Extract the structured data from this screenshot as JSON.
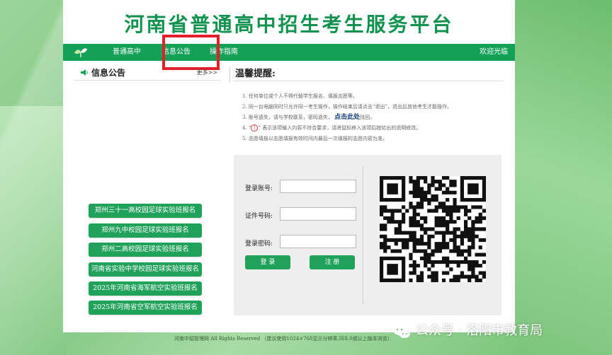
{
  "banner": {
    "title": "河南省普通高中招生考生服务平台"
  },
  "nav": {
    "items": [
      "普通高中",
      "信息公告",
      "操作指南"
    ],
    "welcome": "欢迎光临"
  },
  "info": {
    "title": "信息公告",
    "more": "更多>>",
    "buttons": [
      "郑州三十一高校园足球实验班报名",
      "郑州九中校园足球实验班报名",
      "郑州二高校园足球实验班报名",
      "河南省实验中学校园足球实验班报名",
      "2025年河南省海军航空实验班报名",
      "2025年河南省空军航空实验班报名"
    ]
  },
  "tips": {
    "title": "温馨提醒:",
    "items": [
      "1. 任何单位或个人不得代替学生报名、填报志愿等。",
      "2. 同一台电脑同时只允许同一考生操作，操作结束后请点击“退出”，退出后其他考生才能操作。",
      "3. 账号遗失，请与学校联系，密码遗失，",
      "4. “",
      "5. 志愿填报以志愿填报有效时间内最后一次填报的志愿内容为准。"
    ],
    "item3_link": "点击此处",
    "item3_after": "找回。",
    "item4_symbol": "!",
    "item4_after": "” 表示该项输入内容不符合要求，请将鼠标移入该项后按给出的说明修改。"
  },
  "login": {
    "account_label": "登录账号:",
    "id_label": "证件号码:",
    "password_label": "登录密码:",
    "account_value": "",
    "id_value": "",
    "password_value": "",
    "login_button": "登 录",
    "register_button": "注 册"
  },
  "footer": {
    "text": "河南中招管理网 All Rights Reserved （建议使用1024×768显示分辨率,IE8.0或以上版本浏览）"
  },
  "watermark": {
    "text": "公众号 · 洛阳市教育局"
  },
  "colors": {
    "brand_green": "#13a057",
    "title_green": "#11924e",
    "button_green": "#21a25a",
    "highlight_red": "#e2202a"
  }
}
